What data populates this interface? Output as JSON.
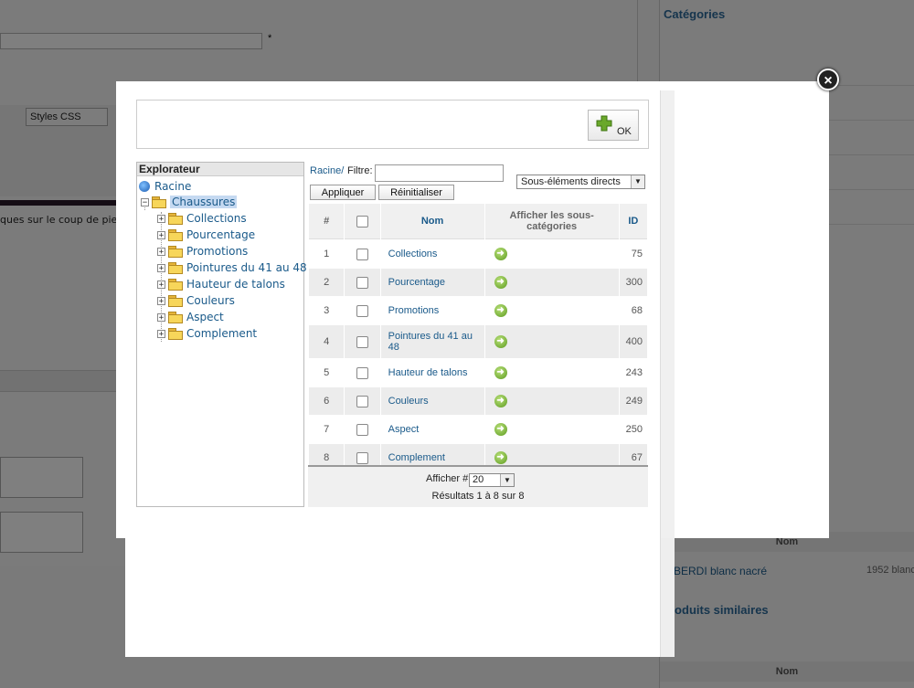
{
  "background": {
    "toolbar_styles": "Styles CSS",
    "snippet_text": "ques sur le coup de pie",
    "categories_title": "Catégories",
    "table_header_nom": "Nom",
    "product_name": "BERDI blanc nacré",
    "product_ref": "1952 blanc",
    "similar_title": "roduits similaires",
    "table_header_nom_2": "Nom"
  },
  "modal": {
    "ok_label": "OK",
    "explorer": {
      "title": "Explorateur",
      "root": "Racine",
      "selected": "Chaussures",
      "children": [
        "Collections",
        "Pourcentage",
        "Promotions",
        "Pointures du 41 au 48",
        "Hauteur de talons",
        "Couleurs",
        "Aspect",
        "Complement"
      ]
    },
    "filter": {
      "breadcrumb": "Racine/",
      "label": "Filtre:",
      "value": "",
      "scope_selected": "Sous-éléments directs",
      "apply_label": "Appliquer",
      "reset_label": "Réinitialiser"
    },
    "table": {
      "headers": {
        "num": "#",
        "nom": "Nom",
        "afficher": "Afficher les sous-catégories",
        "id": "ID"
      },
      "rows": [
        {
          "num": "1",
          "name": "Collections",
          "id": "75"
        },
        {
          "num": "2",
          "name": "Pourcentage",
          "id": "300"
        },
        {
          "num": "3",
          "name": "Promotions",
          "id": "68"
        },
        {
          "num": "4",
          "name": "Pointures du 41 au 48",
          "id": "400"
        },
        {
          "num": "5",
          "name": "Hauteur de talons",
          "id": "243"
        },
        {
          "num": "6",
          "name": "Couleurs",
          "id": "249"
        },
        {
          "num": "7",
          "name": "Aspect",
          "id": "250"
        },
        {
          "num": "8",
          "name": "Complement",
          "id": "67"
        }
      ]
    },
    "pagination": {
      "show_label": "Afficher #",
      "page_size": "20",
      "results_text": "Résultats 1 à 8 sur 8"
    }
  },
  "colors": {
    "link": "#1a5a8a",
    "selected": "#c5d9f1",
    "go_icon": "#6aa82a"
  }
}
